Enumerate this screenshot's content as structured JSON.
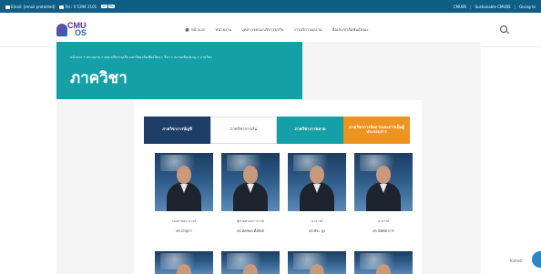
{
  "topbar": {
    "email": "Email: [email protected]",
    "phone": "Tel.: 0 5394 2101",
    "lang": [
      "TH",
      "EN"
    ],
    "links": [
      "CMUBS",
      "Sustainable CMUBS",
      "Giving to"
    ]
  },
  "navbar": {
    "logo": {
      "line1": "CMU",
      "line2": "OS"
    },
    "menu": [
      "หน้าแรก",
      "หน่วยงาน",
      "บุคลากรคณะบริหารธุรกิจ",
      "การบริการผลงาน",
      "สื่อประชาสัมพันธ์คณะ"
    ]
  },
  "hero": {
    "breadcrumb": "หน้าแรก » หน่วยงาน » คณะบริหารธุรกิจ มหาวิทยาลัยเชียงใหม่ » วิชา » ความเชี่ยวชาญ » ภาควิชา",
    "title": "ภาควิชา"
  },
  "tabs": [
    {
      "label": "ภาควิชาการบัญชี"
    },
    {
      "label": "ภาควิชาการเงิน"
    },
    {
      "label": "ภาควิชาการตลาด"
    },
    {
      "label": "ภาควิชาการจัดการและการเป็นผู้ประกอบการ"
    }
  ],
  "people": [
    {
      "role": "รองศาสตราจารย์",
      "name": "ดร.บัวสุภา"
    },
    {
      "role": "ผู้ช่วยศาสตราจารย์",
      "name": "ดร.อัครพล ตั้งสิงห์"
    },
    {
      "role": "อาจารย์",
      "name": "ดร.พีระ สูง"
    },
    {
      "role": "อาจารย์",
      "name": "ดร.นิพัทธ์ การ"
    }
  ],
  "chat": {
    "label": "Kaitest"
  }
}
